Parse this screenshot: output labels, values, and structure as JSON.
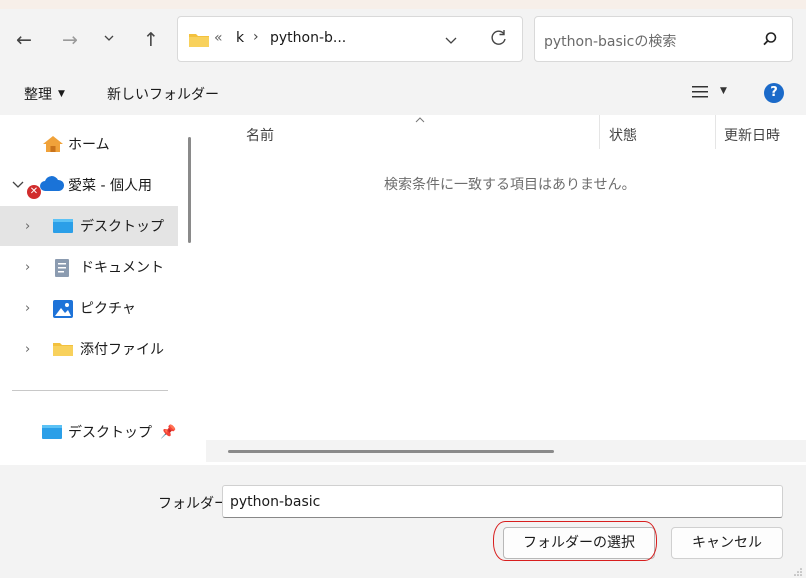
{
  "breadcrumb": {
    "overflow": "«",
    "segments": [
      "k",
      "python-b..."
    ]
  },
  "search": {
    "placeholder": "python-basicの検索"
  },
  "toolbar": {
    "organize": "整理",
    "new_folder": "新しいフォルダー"
  },
  "nav": {
    "home": "ホーム",
    "onedrive": "愛菜 - 個人用",
    "items": [
      "デスクトップ",
      "ドキュメント",
      "ピクチャ",
      "添付ファイル"
    ],
    "pinned": "デスクトップ"
  },
  "columns": [
    "名前",
    "状態",
    "更新日時"
  ],
  "empty_message": "検索条件に一致する項目はありません。",
  "folder_field": {
    "label": "フォルダー:",
    "value": "python-basic"
  },
  "buttons": {
    "select": "フォルダーの選択",
    "cancel": "キャンセル"
  },
  "colors": {
    "accent": "#0067c0",
    "help": "#1b6ac9",
    "annotation": "#d81e1e"
  }
}
